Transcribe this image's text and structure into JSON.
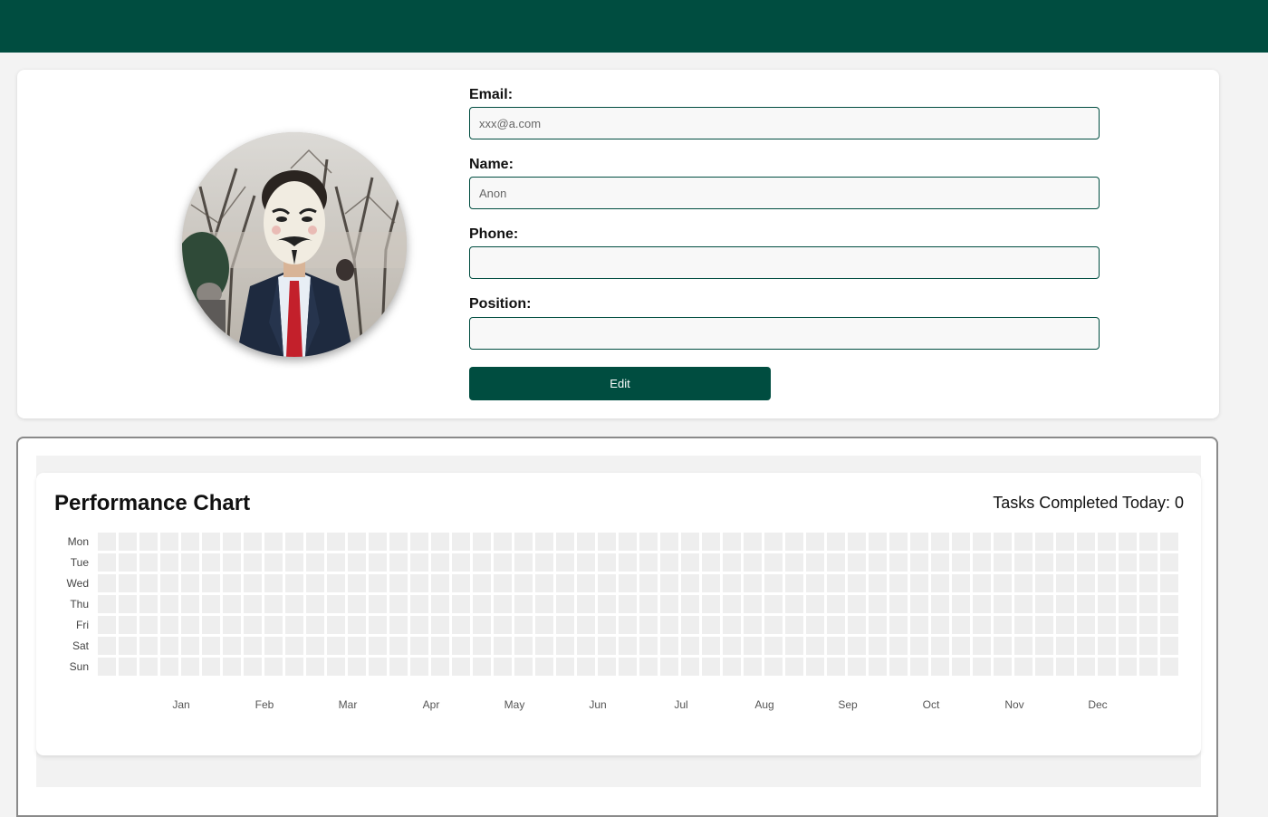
{
  "profile": {
    "avatar_alt": "Profile photo",
    "fields": [
      {
        "key": "email",
        "label": "Email:",
        "placeholder": "xxx@a.com",
        "value": ""
      },
      {
        "key": "name",
        "label": "Name:",
        "placeholder": "Anon",
        "value": ""
      },
      {
        "key": "phone",
        "label": "Phone:",
        "placeholder": "",
        "value": ""
      },
      {
        "key": "position",
        "label": "Position:",
        "placeholder": "",
        "value": ""
      }
    ],
    "edit_label": "Edit"
  },
  "performance": {
    "title": "Performance Chart",
    "tasks_label": "Tasks Completed Today: 0"
  },
  "chart_data": {
    "type": "heatmap",
    "title": "Performance Chart",
    "rows": [
      "Mon",
      "Tue",
      "Wed",
      "Thu",
      "Fri",
      "Sat",
      "Sun"
    ],
    "columns_count": 52,
    "month_labels": [
      "Jan",
      "Feb",
      "Mar",
      "Apr",
      "May",
      "Jun",
      "Jul",
      "Aug",
      "Sep",
      "Oct",
      "Nov",
      "Dec"
    ],
    "values": "all zero",
    "empty_color": "#eeeeee"
  },
  "colors": {
    "brand": "#004d40",
    "background": "#f3f3f3",
    "cell_empty": "#eeeeee"
  }
}
